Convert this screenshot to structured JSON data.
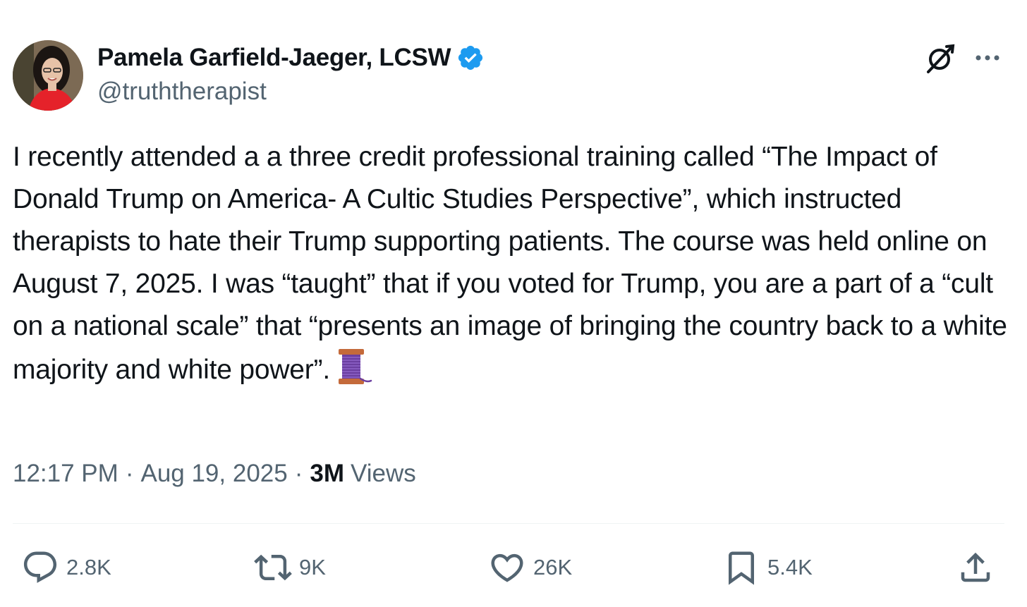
{
  "author": {
    "display_name": "Pamela Garfield-Jaeger, LCSW",
    "handle": "@truththerapist",
    "verified": true,
    "avatar_icon": "profile-photo"
  },
  "tweet": {
    "text": "I recently attended a a three credit professional training called “The Impact of Donald Trump on America- A Cultic Studies Perspective”, which instructed therapists to hate their Trump supporting patients. The course was held online on August 7, 2025. I was “taught” that if you voted for Trump, you are a part of a “cult on a national scale” that “presents an image of bringing the country back to a white majority and white power”.",
    "trailing_emoji": "thread-spool-emoji",
    "time": "12:17 PM",
    "separator": "·",
    "date": "Aug 19, 2025",
    "views_count": "3M",
    "views_label": "Views"
  },
  "actions": {
    "replies": "2.8K",
    "reposts": "9K",
    "likes": "26K",
    "bookmarks": "5.4K"
  },
  "colors": {
    "text": "#0f1419",
    "secondary": "#536471",
    "verified": "#1d9bf0",
    "divider": "#eff3f4"
  }
}
